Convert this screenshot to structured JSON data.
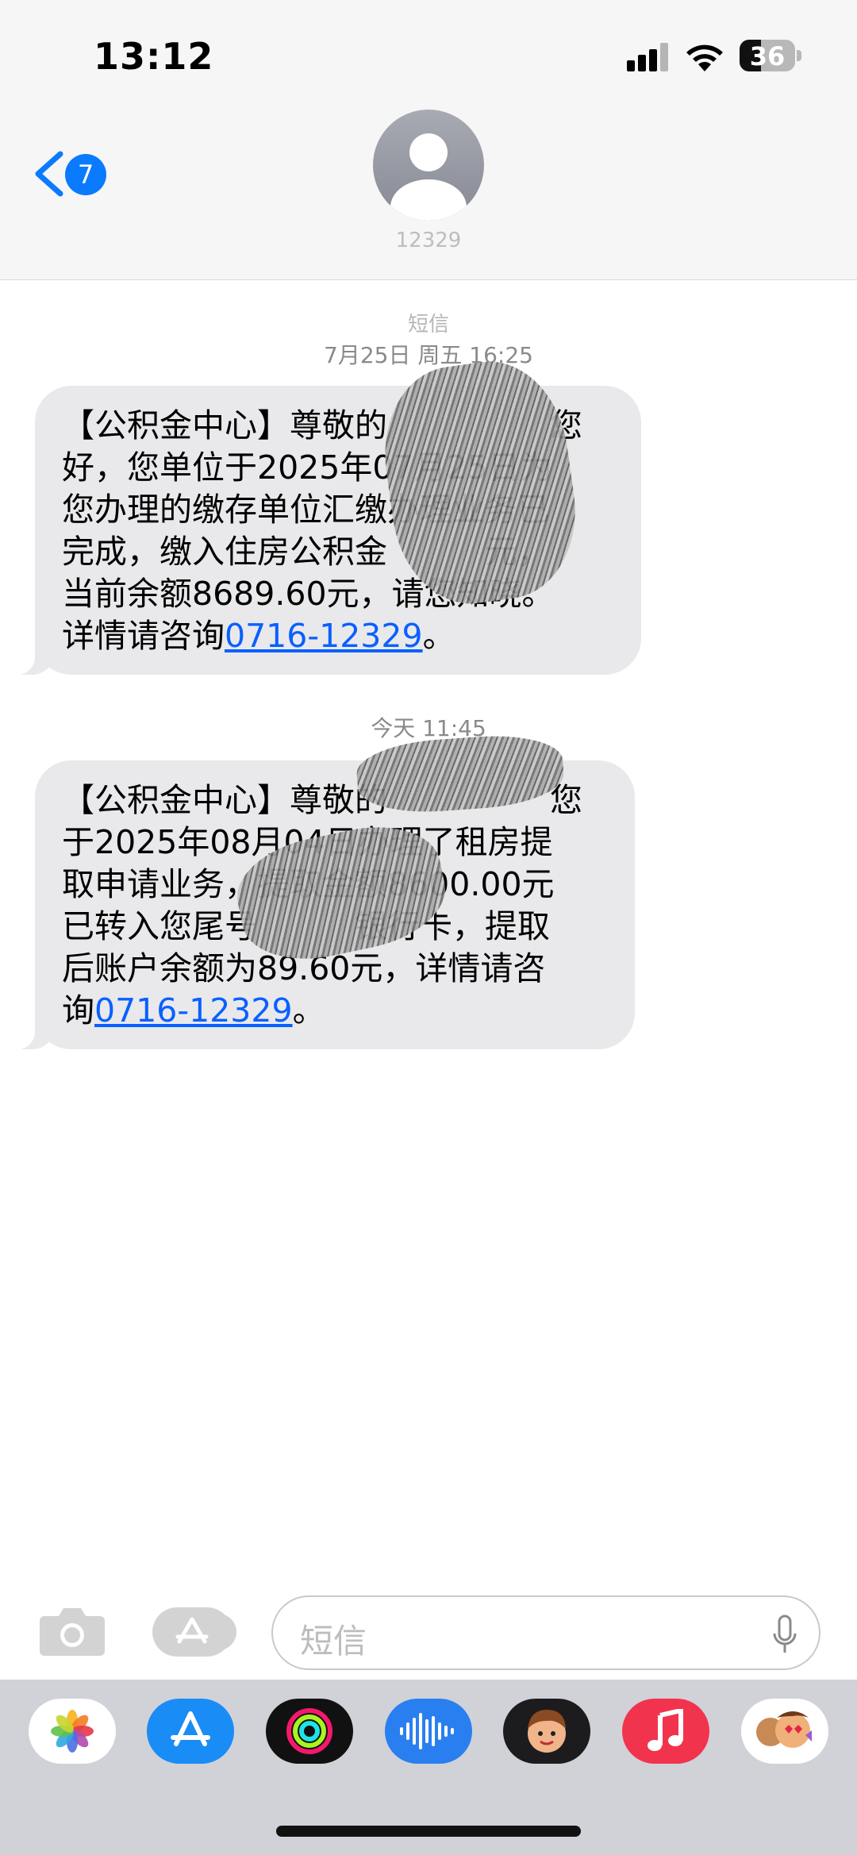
{
  "status_bar": {
    "time": "13:12",
    "battery": "36"
  },
  "header": {
    "back_count": "7",
    "contact": "12329"
  },
  "thread": {
    "service_label": "短信",
    "messages": [
      {
        "timestamp": "7月25日 周五 16:25",
        "lines": [
          "【公积金中心】尊敬的　　　　　您",
          "好，您单位于2025年07月25日为",
          "您办理的缴存单位汇缴办理业务已",
          "完成，缴入住房公积金　　　元，",
          "当前余额8689.60元，请您知晓。"
        ],
        "last_line_prefix": "详情请咨询",
        "phone_link": "0716-12329",
        "last_line_suffix": "。"
      },
      {
        "timestamp": "今天 11:45",
        "lines": [
          "【公积金中心】尊敬的　　　　　您",
          "于2025年08月04日办理了租房提",
          "取申请业务，提取金额8600.00元",
          "已转入您尾号　　　银行卡，提取",
          "后账户余额为89.60元，详情请咨"
        ],
        "last_line_prefix": "询",
        "phone_link": "0716-12329",
        "last_line_suffix": "。"
      }
    ]
  },
  "compose": {
    "placeholder": "短信"
  },
  "dock_apps": [
    "photos-icon",
    "app-store-icon",
    "fitness-icon",
    "voice-memos-icon",
    "memoji-icon",
    "music-icon",
    "memoji-stickers-icon"
  ],
  "colors": {
    "accent": "#0a7aff",
    "bubble": "#e9e9eb",
    "dock": "#d0d2d8"
  }
}
